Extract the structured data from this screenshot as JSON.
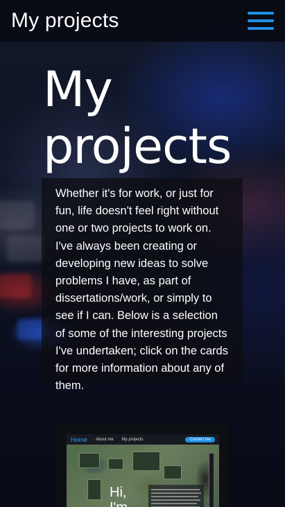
{
  "header": {
    "title": "My projects",
    "menu_icon": "hamburger-menu-icon",
    "accent_color": "#1e90e6"
  },
  "hero": {
    "title_line1": "My",
    "title_line2": "projects"
  },
  "intro": {
    "text": "Whether it's for work, or just for fun, life doesn't feel right without one or two projects to work on. I've always been creating or developing new ideas to solve problems I have, as part of dissertations/work, or simply to see if I can. Below is a selection of some of the interesting projects I've undertaken; click on the cards for more information about any of them."
  },
  "card": {
    "preview_nav": {
      "home": "Home",
      "about": "About me",
      "projects": "My projects",
      "contact": "Contact me"
    },
    "preview_heading_line1": "Hi,",
    "preview_heading_line2": "I'm"
  }
}
